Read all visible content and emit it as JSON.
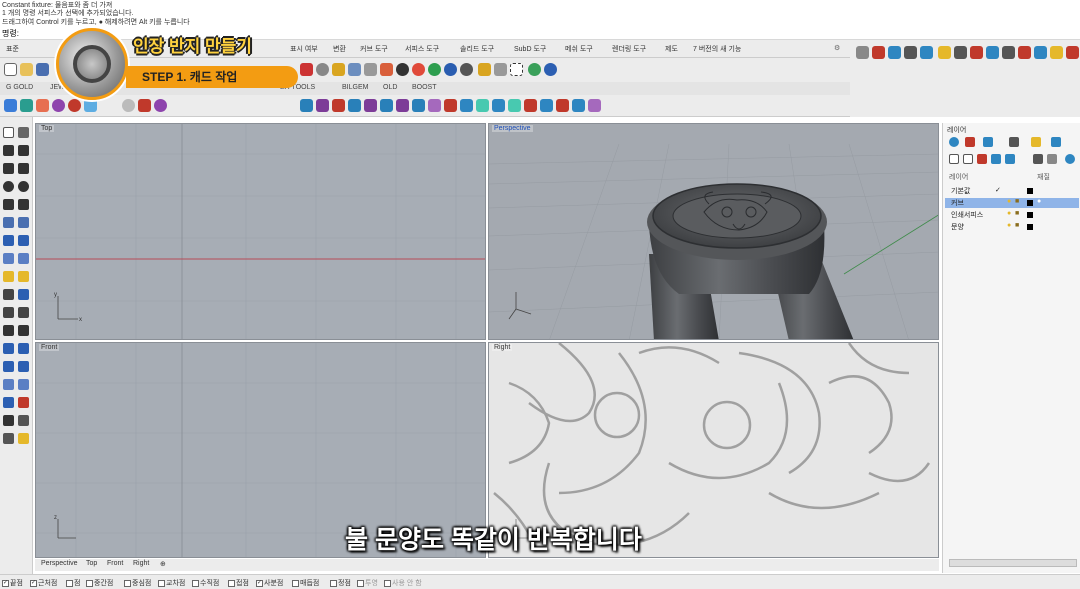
{
  "command_history": {
    "lines": [
      "Constant fixture: 물음표와 좀 더 가져",
      "1 개의 명령 서피스가 선택에 추가되었습니다.",
      "드래그하여 Control 키를 누르고, ● 해제하려면 Alt 키를 누릅니다"
    ],
    "prompt": "명령:"
  },
  "tabs": [
    "표준",
    "",
    "",
    "",
    "",
    "",
    "",
    "",
    "",
    "표시 여부",
    "변환",
    "커브 도구",
    "서피스 도구",
    "솔리드 도구",
    "SubD 도구",
    "메쉬 도구",
    "렌더링 도구",
    "제도",
    "7 버전의 새 기능"
  ],
  "plugin_tabs": [
    "G GOLD",
    "JEW",
    "",
    "",
    "",
    "",
    "ER TOOLS",
    "BILGEM",
    "OLD",
    "BOOST"
  ],
  "viewports": {
    "top": "Top",
    "perspective": "Perspective",
    "front": "Front",
    "right": "Right"
  },
  "viewport_tabs": [
    "Perspective",
    "Top",
    "Front",
    "Right",
    "⊕"
  ],
  "status_snaps": [
    {
      "label": "끝점",
      "checked": true
    },
    {
      "label": "근처점",
      "checked": true
    },
    {
      "label": "점",
      "checked": false
    },
    {
      "label": "중간점",
      "checked": false
    },
    {
      "label": "중심점",
      "checked": false
    },
    {
      "label": "교차점",
      "checked": false
    },
    {
      "label": "수직점",
      "checked": false
    },
    {
      "label": "접점",
      "checked": false
    },
    {
      "label": "사분점",
      "checked": true
    },
    {
      "label": "매듭점",
      "checked": false
    },
    {
      "label": "정점",
      "checked": false
    },
    {
      "label": "투영",
      "checked": false
    },
    {
      "label": "사용 안 함",
      "checked": false
    }
  ],
  "layers_panel": {
    "title": "레이어",
    "header_name": "레이어",
    "header_material": "재질",
    "layers": [
      {
        "name": "기본값",
        "current": true,
        "selected": false
      },
      {
        "name": "커브",
        "current": false,
        "selected": true
      },
      {
        "name": "인쇄서피스",
        "current": false,
        "selected": false
      },
      {
        "name": "문양",
        "current": false,
        "selected": false
      }
    ]
  },
  "overlay": {
    "title": "인장 반지 만들기",
    "step": "STEP 1. 캐드 작업",
    "subtitle": "불 문양도 똑같이 반복합니다"
  },
  "colors": {
    "accent": "#f39c12",
    "title_yellow": "#ffd23f",
    "layer_selected": "#8fb4e8",
    "viewport_bg": "#a7adb5"
  }
}
